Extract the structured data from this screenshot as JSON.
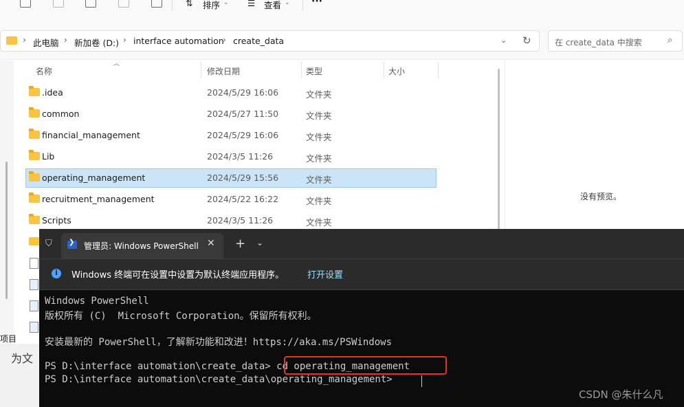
{
  "toolbar": {
    "sort_label": "排序",
    "view_label": "查看",
    "more_label": "···"
  },
  "address": {
    "crumbs": [
      "此电脑",
      "新加卷 (D:)",
      "interface automation",
      "create_data"
    ],
    "search_placeholder": "在 create_data 中搜索"
  },
  "columns": {
    "name": "名称",
    "date": "修改日期",
    "type": "类型",
    "size": "大小"
  },
  "files": [
    {
      "name": ".idea",
      "date": "2024/5/29 16:06",
      "type": "文件夹"
    },
    {
      "name": "common",
      "date": "2024/5/27 11:50",
      "type": "文件夹"
    },
    {
      "name": "financial_management",
      "date": "2024/5/29 16:06",
      "type": "文件夹"
    },
    {
      "name": "Lib",
      "date": "2024/3/5 11:26",
      "type": "文件夹"
    },
    {
      "name": "operating_management",
      "date": "2024/5/29 15:56",
      "type": "文件夹",
      "selected": true
    },
    {
      "name": "recruitment_management",
      "date": "2024/5/22 16:22",
      "type": "文件夹"
    },
    {
      "name": "Scripts",
      "date": "2024/3/5 11:26",
      "type": "文件夹"
    }
  ],
  "preview": {
    "text": "没有预览。"
  },
  "status": {
    "items_label": "项目"
  },
  "background_fragment": "为文",
  "terminal": {
    "tab_title": "管理员: Windows PowerShell",
    "new_tab": "+",
    "info_text": "Windows 终端可在设置中设置为默认终端应用程序。",
    "info_link": "打开设置",
    "lines": [
      "Windows PowerShell",
      "版权所有 (C)  Microsoft Corporation。保留所有权利。",
      "",
      "安装最新的 PowerShell，了解新功能和改进！https://aka.ms/PSWindows",
      "",
      "PS D:\\interface automation\\create_data> cd operating_management",
      "PS D:\\interface automation\\create_data\\operating_management> "
    ]
  },
  "watermark": "CSDN @朱什么凡",
  "colors": {
    "selection": "#cce4f7",
    "terminal_bg": "#0c0c0c",
    "highlight": "#e0352b",
    "link": "#9cdcfe"
  }
}
